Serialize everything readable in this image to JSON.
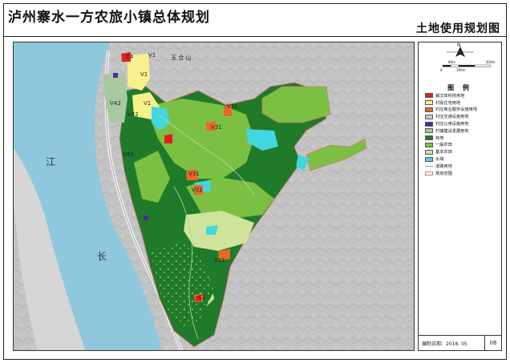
{
  "header": {
    "title": "泸州寨水一方农旅小镇总体规划",
    "subtitle": "土地使用规划图"
  },
  "compass": {
    "label": "N"
  },
  "scale": {
    "labels": [
      "0",
      "80m",
      "160m",
      "400m"
    ]
  },
  "legend": {
    "title": "图 例",
    "items": [
      {
        "label": "镇文体科技用地",
        "color": "#e02020",
        "kind": "fill"
      },
      {
        "label": "村民住宅用地",
        "color": "#f7f08c",
        "kind": "fill"
      },
      {
        "label": "村庄商业服务设施用地",
        "color": "#e8682a",
        "kind": "fill"
      },
      {
        "label": "村庄交通设施用地",
        "color": "#c8c8c8",
        "kind": "fill"
      },
      {
        "label": "村庄公用设施用地",
        "color": "#4a2aa0",
        "kind": "fill"
      },
      {
        "label": "村镇建设发展用地",
        "color": "#a8c8a0",
        "kind": "fill"
      },
      {
        "label": "林地",
        "color": "#1f7a2a",
        "kind": "fill"
      },
      {
        "label": "一般农田",
        "color": "#7bc043",
        "kind": "fill"
      },
      {
        "label": "基本农田",
        "color": "#cfe39a",
        "kind": "fill"
      },
      {
        "label": "水域",
        "color": "#41d6e0",
        "kind": "fill"
      },
      {
        "label": "道路用地",
        "color": "#9a9a9a",
        "kind": "line"
      },
      {
        "label": "规划范围",
        "color": "#d77777",
        "kind": "outline"
      }
    ]
  },
  "map_labels": {
    "river_1": "江",
    "river_2": "长",
    "place": "玉 合 山",
    "v1a": "V1",
    "v1b": "V1",
    "v1c": "V1",
    "v42a": "V42",
    "v42b": "V42",
    "v43": "V43",
    "v31a": "V31",
    "v31b": "V31",
    "v31c": "V31",
    "v31d": "V31",
    "v31e": "V31",
    "c4": "C4",
    "c3": "C3"
  },
  "footer": {
    "date": "编制日期：2018. 05",
    "page": "06"
  }
}
